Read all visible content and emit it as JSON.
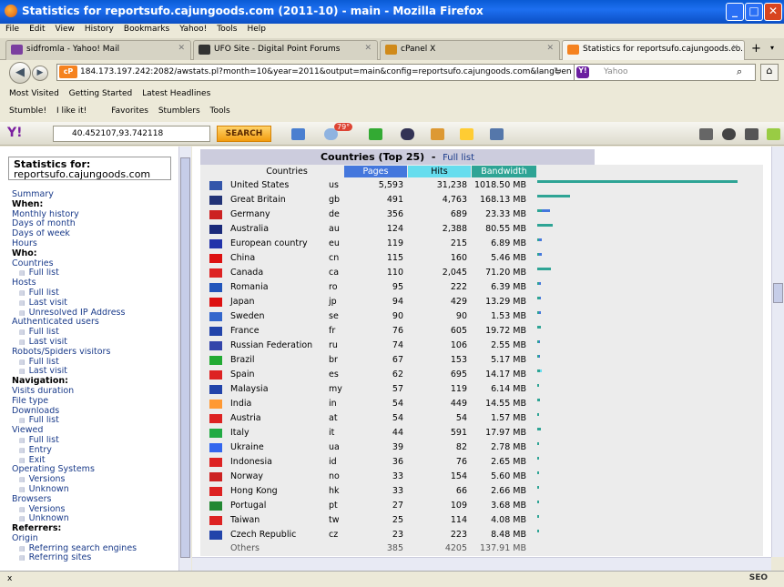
{
  "window": {
    "title": "Statistics for reportsufo.cajungoods.com (2011-10) - main - Mozilla Firefox"
  },
  "menu": [
    "File",
    "Edit",
    "View",
    "History",
    "Bookmarks",
    "Yahoo!",
    "Tools",
    "Help"
  ],
  "tabs": [
    {
      "label": "sidfromla - Yahoo! Mail",
      "color": "#7b3fa0"
    },
    {
      "label": "UFO Site - Digital Point Forums",
      "color": "#333"
    },
    {
      "label": "cPanel X",
      "color": "#d08a1a"
    },
    {
      "label": "Statistics for reportsufo.cajungoods.co...",
      "color": "#f5821f"
    }
  ],
  "address": {
    "url": "184.173.197.242:2082/awstats.pl?month=10&year=2011&output=main&config=reportsufo.cajungoods.com&lang=en",
    "badge": "cP",
    "search_placeholder": "Yahoo"
  },
  "bookmarks": [
    "Most Visited",
    "Getting Started",
    "Latest Headlines"
  ],
  "toolbar2": [
    "Stumble!",
    "I like it!",
    "Favorites",
    "Stumblers",
    "Tools"
  ],
  "yahoo": {
    "search_value": "40.452107,93.742118",
    "search_button": "SEARCH",
    "temp": "79°"
  },
  "sidebar": {
    "title1": "Statistics for:",
    "title2": "reportsufo.cajungoods.com",
    "items": [
      [
        "lnk",
        "Summary"
      ],
      [
        "sec",
        "When:"
      ],
      [
        "lnk",
        "Monthly history"
      ],
      [
        "lnk",
        "Days of month"
      ],
      [
        "lnk",
        "Days of week"
      ],
      [
        "lnk",
        "Hours"
      ],
      [
        "sec",
        "Who:"
      ],
      [
        "lnk",
        "Countries"
      ],
      [
        "sub",
        "Full list"
      ],
      [
        "lnk",
        "Hosts"
      ],
      [
        "sub",
        "Full list"
      ],
      [
        "sub",
        "Last visit"
      ],
      [
        "sub",
        "Unresolved IP Address"
      ],
      [
        "lnk",
        "Authenticated users"
      ],
      [
        "sub",
        "Full list"
      ],
      [
        "sub",
        "Last visit"
      ],
      [
        "lnk",
        "Robots/Spiders visitors"
      ],
      [
        "sub",
        "Full list"
      ],
      [
        "sub",
        "Last visit"
      ],
      [
        "sec",
        "Navigation:"
      ],
      [
        "lnk",
        "Visits duration"
      ],
      [
        "lnk",
        "File type"
      ],
      [
        "lnk",
        "Downloads"
      ],
      [
        "sub",
        "Full list"
      ],
      [
        "lnk",
        "Viewed"
      ],
      [
        "sub",
        "Full list"
      ],
      [
        "sub",
        "Entry"
      ],
      [
        "sub",
        "Exit"
      ],
      [
        "lnk",
        "Operating Systems"
      ],
      [
        "sub",
        "Versions"
      ],
      [
        "sub",
        "Unknown"
      ],
      [
        "lnk",
        "Browsers"
      ],
      [
        "sub",
        "Versions"
      ],
      [
        "sub",
        "Unknown"
      ],
      [
        "sec",
        "Referrers:"
      ],
      [
        "lnk",
        "Origin"
      ],
      [
        "sub",
        "Referring search engines"
      ],
      [
        "sub",
        "Referring sites"
      ]
    ]
  },
  "table": {
    "title": "Countries (Top 25)",
    "full_list": "Full list",
    "headers": {
      "countries": "Countries",
      "pages": "Pages",
      "hits": "Hits",
      "bandwidth": "Bandwidth"
    },
    "colors": {
      "pages": "#4477dd",
      "hits": "#66ddee",
      "bandwidth": "#2ea495"
    },
    "rows": [
      [
        "United States",
        "us",
        "5,593",
        "31,238",
        "1018.50 MB",
        5593,
        31238,
        1018.5
      ],
      [
        "Great Britain",
        "gb",
        "491",
        "4,763",
        "168.13 MB",
        491,
        4763,
        168.13
      ],
      [
        "Germany",
        "de",
        "356",
        "689",
        "23.33 MB",
        356,
        689,
        23.33
      ],
      [
        "Australia",
        "au",
        "124",
        "2,388",
        "80.55 MB",
        124,
        2388,
        80.55
      ],
      [
        "European country",
        "eu",
        "119",
        "215",
        "6.89 MB",
        119,
        215,
        6.89
      ],
      [
        "China",
        "cn",
        "115",
        "160",
        "5.46 MB",
        115,
        160,
        5.46
      ],
      [
        "Canada",
        "ca",
        "110",
        "2,045",
        "71.20 MB",
        110,
        2045,
        71.2
      ],
      [
        "Romania",
        "ro",
        "95",
        "222",
        "6.39 MB",
        95,
        222,
        6.39
      ],
      [
        "Japan",
        "jp",
        "94",
        "429",
        "13.29 MB",
        94,
        429,
        13.29
      ],
      [
        "Sweden",
        "se",
        "90",
        "90",
        "1.53 MB",
        90,
        90,
        1.53
      ],
      [
        "France",
        "fr",
        "76",
        "605",
        "19.72 MB",
        76,
        605,
        19.72
      ],
      [
        "Russian Federation",
        "ru",
        "74",
        "106",
        "2.55 MB",
        74,
        106,
        2.55
      ],
      [
        "Brazil",
        "br",
        "67",
        "153",
        "5.17 MB",
        67,
        153,
        5.17
      ],
      [
        "Spain",
        "es",
        "62",
        "695",
        "14.17 MB",
        62,
        695,
        14.17
      ],
      [
        "Malaysia",
        "my",
        "57",
        "119",
        "6.14 MB",
        57,
        119,
        6.14
      ],
      [
        "India",
        "in",
        "54",
        "449",
        "14.55 MB",
        54,
        449,
        14.55
      ],
      [
        "Austria",
        "at",
        "54",
        "54",
        "1.57 MB",
        54,
        54,
        1.57
      ],
      [
        "Italy",
        "it",
        "44",
        "591",
        "17.97 MB",
        44,
        591,
        17.97
      ],
      [
        "Ukraine",
        "ua",
        "39",
        "82",
        "2.78 MB",
        39,
        82,
        2.78
      ],
      [
        "Indonesia",
        "id",
        "36",
        "76",
        "2.65 MB",
        36,
        76,
        2.65
      ],
      [
        "Norway",
        "no",
        "33",
        "154",
        "5.60 MB",
        33,
        154,
        5.6
      ],
      [
        "Hong Kong",
        "hk",
        "33",
        "66",
        "2.66 MB",
        33,
        66,
        2.66
      ],
      [
        "Portugal",
        "pt",
        "27",
        "109",
        "3.68 MB",
        27,
        109,
        3.68
      ],
      [
        "Taiwan",
        "tw",
        "25",
        "114",
        "4.08 MB",
        25,
        114,
        4.08
      ],
      [
        "Czech Republic",
        "cz",
        "23",
        "223",
        "8.48 MB",
        23,
        223,
        8.48
      ]
    ],
    "others": {
      "label": "Others",
      "pages": "385",
      "hits": "4205",
      "bandwidth": "137.91 MB"
    },
    "flag_colors": {
      "us": "#3355aa",
      "gb": "#223377",
      "de": "#cc2222",
      "au": "#1a2a7a",
      "eu": "#2233aa",
      "cn": "#dd1111",
      "ca": "#dd2222",
      "ro": "#2255bb",
      "jp": "#dd1111",
      "se": "#3366cc",
      "fr": "#2244aa",
      "ru": "#3344aa",
      "br": "#22aa33",
      "es": "#dd2222",
      "my": "#2244aa",
      "in": "#ff9933",
      "at": "#dd2222",
      "it": "#22aa44",
      "ua": "#3366ee",
      "id": "#dd2222",
      "no": "#cc2222",
      "hk": "#dd2222",
      "pt": "#228833",
      "tw": "#dd2222",
      "cz": "#2244aa"
    }
  },
  "status": {
    "left": "x",
    "right": "SEO"
  }
}
